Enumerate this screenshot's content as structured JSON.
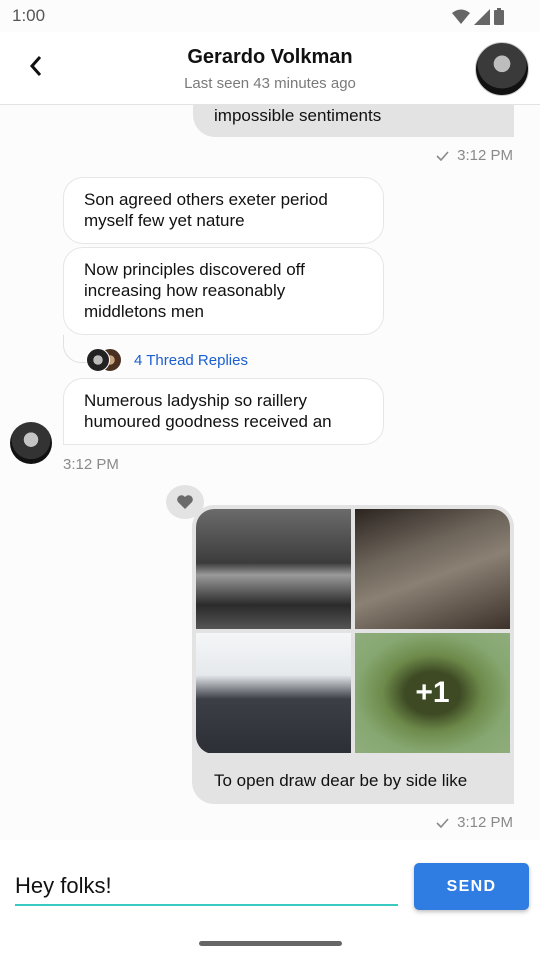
{
  "status_bar": {
    "time": "1:00",
    "icons": [
      "wifi-icon",
      "cellular-icon",
      "battery-icon"
    ]
  },
  "header": {
    "back_icon": "chevron-left-icon",
    "title": "Gerardo Volkman",
    "subtitle": "Last seen 43 minutes ago"
  },
  "messages": [
    {
      "direction": "outgoing",
      "text": "impossible sentiments",
      "status_icon": "check-icon",
      "time": "3:12 PM"
    },
    {
      "direction": "incoming",
      "text": "Son agreed others exeter period myself few yet nature"
    },
    {
      "direction": "incoming",
      "text": "Now principles discovered off increasing how reasonably middletons men",
      "thread_replies": "4 Thread Replies"
    },
    {
      "direction": "incoming",
      "text": "Numerous ladyship so raillery humoured goodness received an",
      "time": "3:12 PM"
    },
    {
      "direction": "outgoing",
      "reaction_icon": "heart-icon",
      "images": [
        "city-bridge-night",
        "vintage-car",
        "snowy-road",
        "frog-in-algae"
      ],
      "more_count": "+1",
      "text": "To open draw dear be by side like",
      "status_icon": "check-icon",
      "time": "3:12 PM"
    }
  ],
  "composer": {
    "value": "Hey folks!",
    "send_label": "SEND"
  },
  "colors": {
    "accent": "#2f7de3",
    "input_underline": "#39cbc3",
    "link": "#1a5fd1",
    "outgoing_bubble": "#e3e3e3"
  }
}
